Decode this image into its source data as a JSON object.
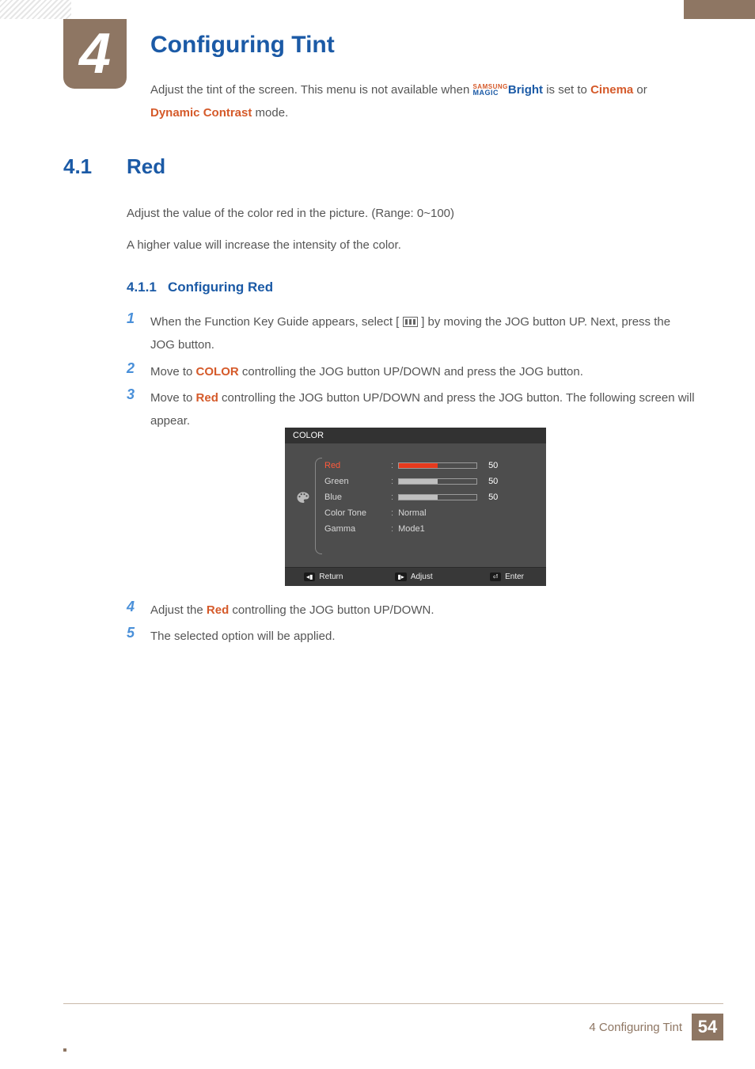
{
  "chapter": {
    "number": "4",
    "title": "Configuring Tint",
    "intro_prefix": "Adjust the tint of the screen. This menu is not available when ",
    "magic_top": "SAMSUNG",
    "magic_bot": "MAGIC",
    "bright": "Bright",
    "intro_mid": " is set to ",
    "cinema": "Cinema",
    "intro_or": " or ",
    "dynamic_contrast": "Dynamic Contrast",
    "intro_suffix": " mode."
  },
  "section": {
    "number": "4.1",
    "title": "Red",
    "p_range": "Adjust the value of the color red in the picture. (Range: 0~100)",
    "p_higher": "A higher value will increase the intensity of the color."
  },
  "subsection": {
    "number": "4.1.1",
    "title": "Configuring Red"
  },
  "steps": [
    {
      "num": "1",
      "pre": "When the Function Key Guide appears, select [",
      "post": "] by moving the JOG button UP. Next, press the JOG button."
    },
    {
      "num": "2",
      "pre": "Move to ",
      "keyword": "COLOR",
      "post": " controlling the JOG button UP/DOWN and press the JOG button."
    },
    {
      "num": "3",
      "pre": "Move to ",
      "keyword": "Red",
      "post": " controlling the JOG button UP/DOWN and press the JOG button. The following screen will appear."
    },
    {
      "num": "4",
      "pre": "Adjust the ",
      "keyword": "Red",
      "post": " controlling the JOG button UP/DOWN."
    },
    {
      "num": "5",
      "pre": "The selected option will be applied."
    }
  ],
  "osd": {
    "header": "COLOR",
    "rows": {
      "red": {
        "label": "Red",
        "value": "50"
      },
      "green": {
        "label": "Green",
        "value": "50"
      },
      "blue": {
        "label": "Blue",
        "value": "50"
      },
      "colortone": {
        "label": "Color Tone",
        "value": "Normal"
      },
      "gamma": {
        "label": "Gamma",
        "value": "Mode1"
      }
    },
    "footer": {
      "return": "Return",
      "adjust": "Adjust",
      "enter": "Enter"
    }
  },
  "footer": {
    "title": "4 Configuring Tint",
    "page": "54"
  }
}
